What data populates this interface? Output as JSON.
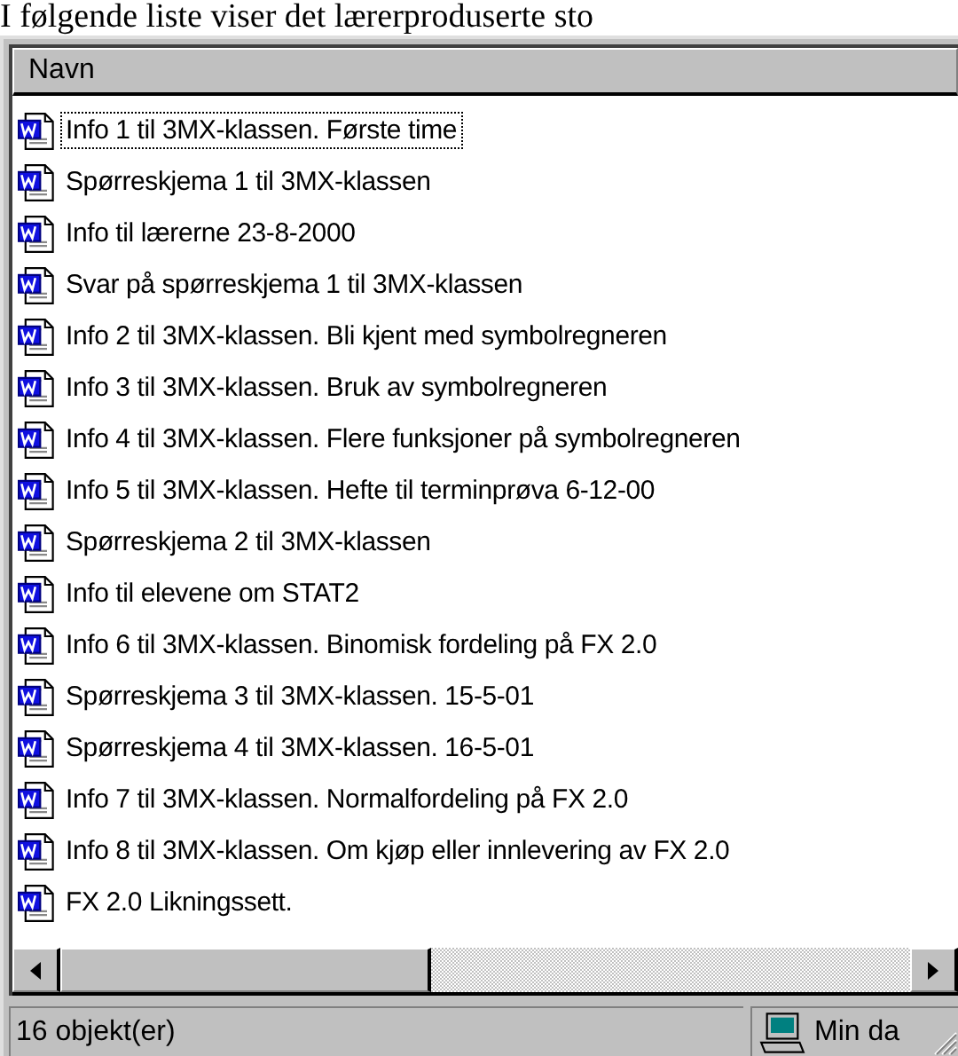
{
  "caption": "I følgende liste viser det lærerproduserte sto",
  "list": {
    "columns": [
      "Navn"
    ],
    "items": [
      {
        "name": "Info 1 til 3MX-klassen. Første time",
        "focused": true
      },
      {
        "name": "Spørreskjema 1 til 3MX-klassen",
        "focused": false
      },
      {
        "name": "Info til lærerne 23-8-2000",
        "focused": false
      },
      {
        "name": "Svar på spørreskjema 1 til 3MX-klassen",
        "focused": false
      },
      {
        "name": "Info 2 til 3MX-klassen. Bli kjent med symbolregneren",
        "focused": false
      },
      {
        "name": "Info 3 til 3MX-klassen. Bruk av symbolregneren",
        "focused": false
      },
      {
        "name": "Info 4 til 3MX-klassen. Flere funksjoner på symbolregneren",
        "focused": false
      },
      {
        "name": "Info 5 til 3MX-klassen. Hefte til terminprøva 6-12-00",
        "focused": false
      },
      {
        "name": "Spørreskjema 2 til 3MX-klassen",
        "focused": false
      },
      {
        "name": "Info til elevene om STAT2",
        "focused": false
      },
      {
        "name": "Info 6 til 3MX-klassen. Binomisk fordeling på FX 2.0",
        "focused": false
      },
      {
        "name": "Spørreskjema 3 til 3MX-klassen. 15-5-01",
        "focused": false
      },
      {
        "name": "Spørreskjema 4 til 3MX-klassen. 16-5-01",
        "focused": false
      },
      {
        "name": "Info 7 til 3MX-klassen. Normalfordeling på FX 2.0",
        "focused": false
      },
      {
        "name": "Info 8 til 3MX-klassen. Om kjøp eller innlevering av FX 2.0",
        "focused": false
      },
      {
        "name": "FX 2.0 Likningssett.",
        "focused": false
      }
    ]
  },
  "status_bar": {
    "count": "16 objekt(er)",
    "location": "Min da"
  }
}
